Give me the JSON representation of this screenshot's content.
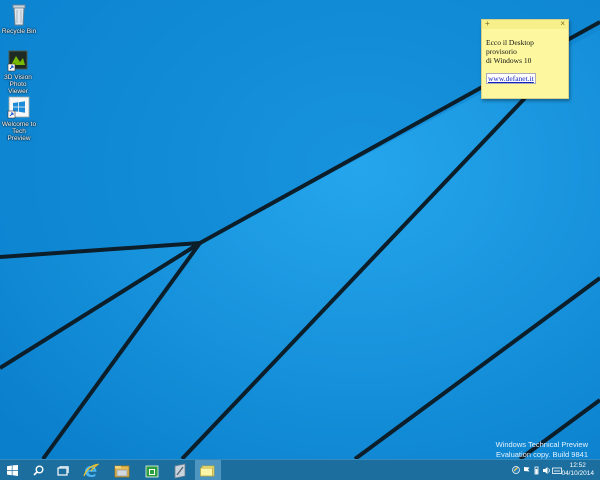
{
  "desktop_icons": [
    {
      "label": "Recycle Bin",
      "icon": "recycle-bin-icon"
    },
    {
      "label": "3D Vision Photo Viewer",
      "icon": "3d-vision-icon"
    },
    {
      "label": "Welcome to Tech Preview",
      "icon": "windows-logo-icon"
    }
  ],
  "sticky_note": {
    "line1": "Ecco il Desktop provisorio",
    "line2": "di Windows 10",
    "link": "www.defanet.it",
    "add_glyph": "+",
    "close_glyph": "×"
  },
  "watermark": {
    "line1": "Windows Technical Preview",
    "line2": "Evaluation copy. Build 9841"
  },
  "taskbar": {
    "apps": [
      "start-icon",
      "search-icon",
      "task-view-icon",
      "internet-explorer-icon",
      "file-explorer-icon",
      "store-icon",
      "app-icon",
      "sticky-notes-icon"
    ],
    "tray_icons": [
      "network-icon",
      "flag-icon",
      "battery-icon",
      "volume-icon",
      "keyboard-icon"
    ],
    "clock_time": "12:52",
    "clock_date": "04/10/2014"
  },
  "colors": {
    "wallpaper": "#0e8ed6",
    "taskbar": "#1c6e9e",
    "note": "#fdf8a0"
  }
}
